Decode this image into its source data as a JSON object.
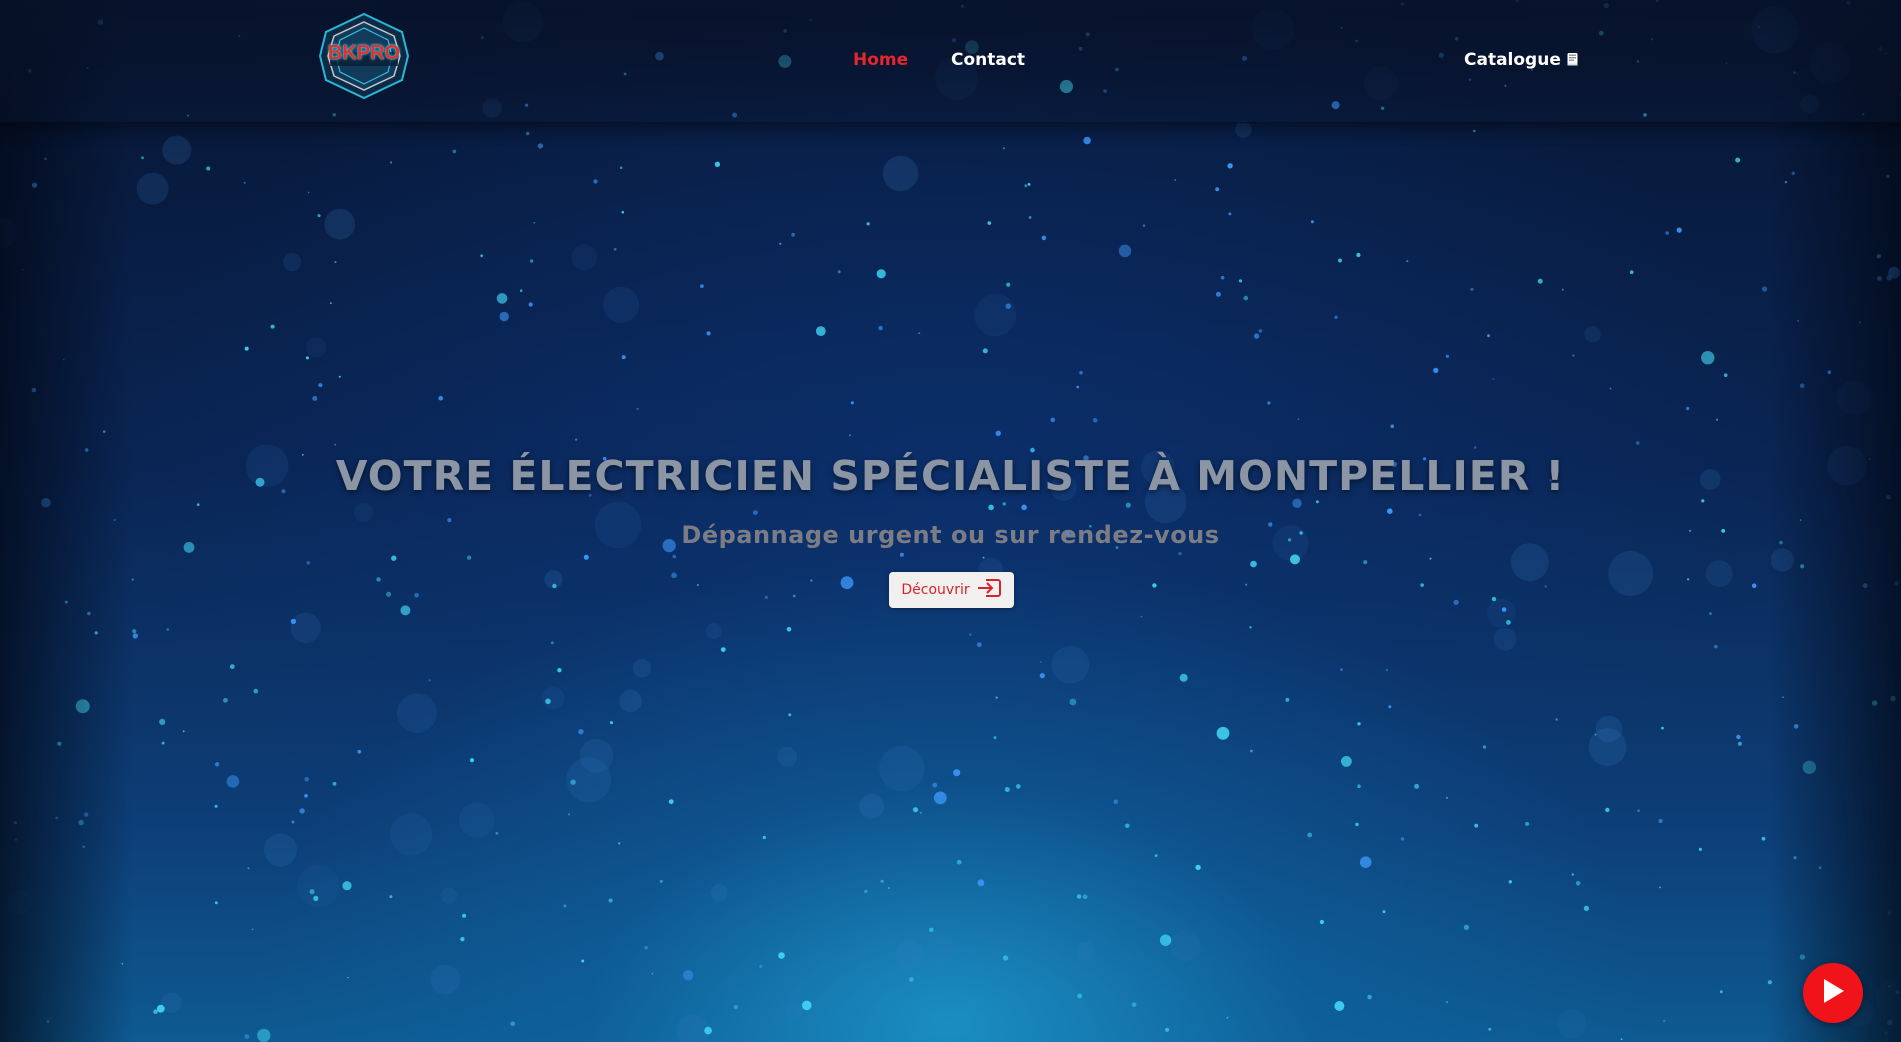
{
  "logo": {
    "text": "BKPRO"
  },
  "nav": {
    "items": [
      {
        "label": "Home",
        "active": true
      },
      {
        "label": "Contact",
        "active": false
      },
      {
        "label": "Catalogue",
        "icon": "book-icon"
      }
    ]
  },
  "hero": {
    "title": "VOTRE ÉLECTRICIEN SPÉCIALISTE À MONTPELLIER !",
    "subtitle": "Dépannage urgent ou sur rendez-vous",
    "cta_label": "Découvrir",
    "cta_icon": "sign-in-icon"
  },
  "floating": {
    "play_icon": "play-icon"
  },
  "colors": {
    "accent_red": "#e5262c",
    "nav_text": "#ffffff",
    "title_gray": "#8c95a4",
    "button_bg": "#f1f0ee",
    "particle_blue": "#3fc4ff"
  }
}
